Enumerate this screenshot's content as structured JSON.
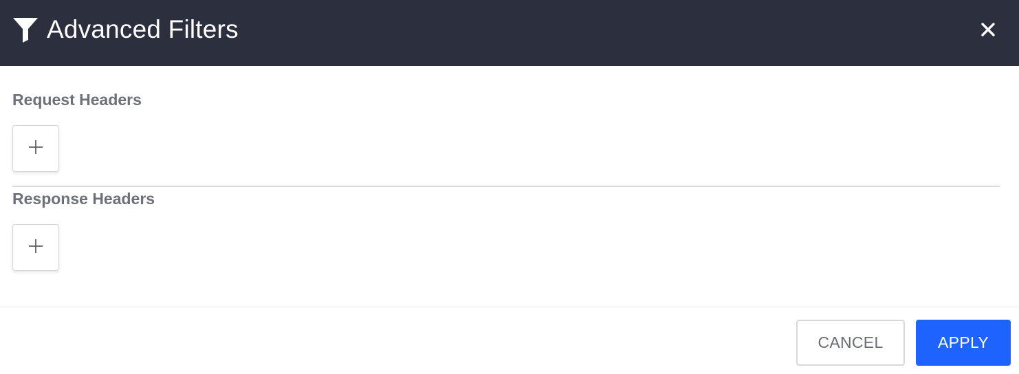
{
  "dialog": {
    "title": "Advanced Filters",
    "title_icon": "filter-icon",
    "close_icon": "close-icon"
  },
  "sections": [
    {
      "label": "Request Headers",
      "add_icon": "plus-icon"
    },
    {
      "label": "Response Headers",
      "add_icon": "plus-icon"
    }
  ],
  "footer": {
    "cancel_label": "CANCEL",
    "apply_label": "APPLY"
  },
  "colors": {
    "header_bg": "#2b2f3e",
    "accent": "#1f63ff",
    "label_text": "#6e7079"
  }
}
